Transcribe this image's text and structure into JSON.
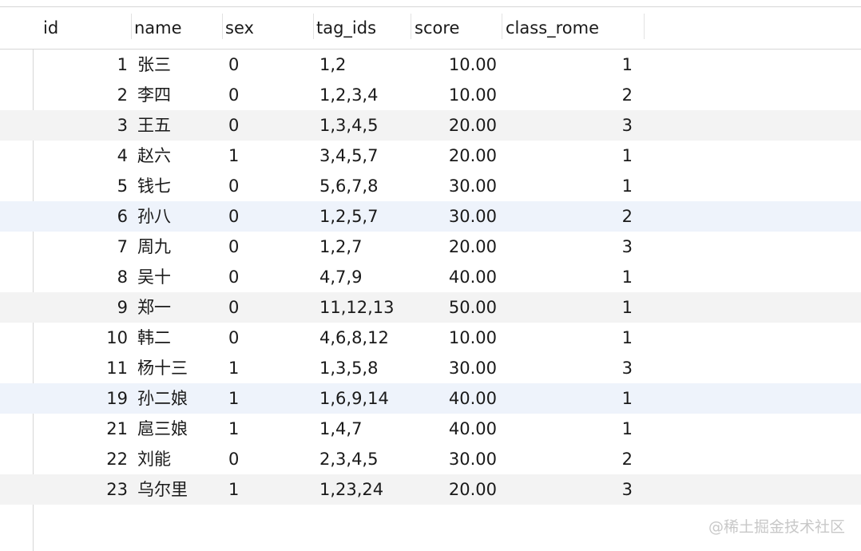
{
  "table": {
    "columns": [
      "id",
      "name",
      "sex",
      "tag_ids",
      "score",
      "class_rome"
    ],
    "rows": [
      [
        "1",
        "张三",
        "0",
        "1,2",
        "10.00",
        "1"
      ],
      [
        "2",
        "李四",
        "0",
        "1,2,3,4",
        "10.00",
        "2"
      ],
      [
        "3",
        "王五",
        "0",
        "1,3,4,5",
        "20.00",
        "3"
      ],
      [
        "4",
        "赵六",
        "1",
        "3,4,5,7",
        "20.00",
        "1"
      ],
      [
        "5",
        "钱七",
        "0",
        "5,6,7,8",
        "30.00",
        "1"
      ],
      [
        "6",
        "孙八",
        "0",
        "1,2,5,7",
        "30.00",
        "2"
      ],
      [
        "7",
        "周九",
        "0",
        "1,2,7",
        "20.00",
        "3"
      ],
      [
        "8",
        "吴十",
        "0",
        "4,7,9",
        "40.00",
        "1"
      ],
      [
        "9",
        "郑一",
        "0",
        "11,12,13",
        "50.00",
        "1"
      ],
      [
        "10",
        "韩二",
        "0",
        "4,6,8,12",
        "10.00",
        "1"
      ],
      [
        "11",
        "杨十三",
        "1",
        "1,3,5,8",
        "30.00",
        "3"
      ],
      [
        "19",
        "孙二娘",
        "1",
        "1,6,9,14",
        "40.00",
        "1"
      ],
      [
        "21",
        "扈三娘",
        "1",
        "1,4,7",
        "40.00",
        "1"
      ],
      [
        "22",
        "刘能",
        "0",
        "2,3,4,5",
        "30.00",
        "2"
      ],
      [
        "23",
        "乌尔里",
        "1",
        "1,23,24",
        "20.00",
        "3"
      ]
    ]
  },
  "watermark": "@稀土掘金技术社区"
}
